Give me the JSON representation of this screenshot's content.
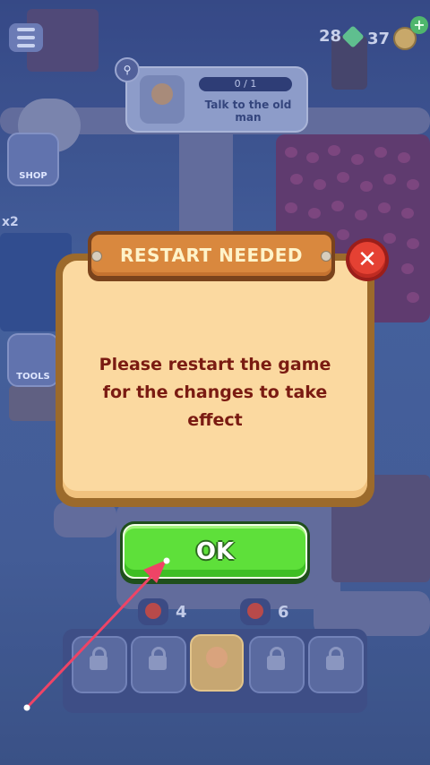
{
  "hud": {
    "gems": "28",
    "coins": "37",
    "plus_label": "+"
  },
  "quest": {
    "progress": "0 / 1",
    "text": "Talk to the old man"
  },
  "sidebar": {
    "shop_label": "SHOP",
    "tools_label": "TOOLS",
    "multiplier": "x2"
  },
  "inventory": {
    "tomato_count_1": "4",
    "tomato_count_2": "6"
  },
  "dialog": {
    "title": "RESTART NEEDED",
    "message_line1": "Please restart the game",
    "message_line2": "for the changes to take",
    "message_line3": "effect",
    "close_label": "✕",
    "ok_label": "OK"
  },
  "colors": {
    "dialog_bg": "#fbd9a0",
    "title_bg": "#d9883e",
    "ok_green": "#5ee03a",
    "close_red": "#e54133",
    "message_text": "#7a1b12",
    "arrow": "#ee4466"
  }
}
